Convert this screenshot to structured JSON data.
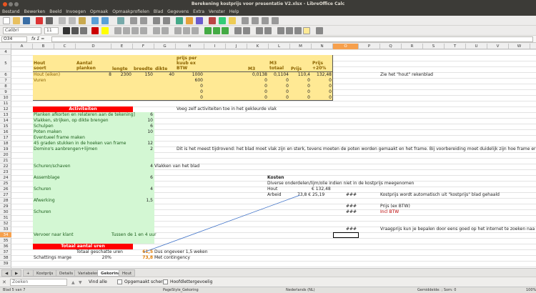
{
  "window": {
    "title": "Berekening kostprijs voor presentatie V2.xlsx - LibreOffice Calc"
  },
  "menu": [
    "Bestand",
    "Bewerken",
    "Beeld",
    "Invoegen",
    "Opmaak",
    "Opmaakprofielen",
    "Blad",
    "Gegevens",
    "Extra",
    "Venster",
    "Help"
  ],
  "toolbar": {
    "font_name": "Calibri",
    "font_size": "11"
  },
  "formula_bar": {
    "name_box": "O34",
    "fx": "fx Σ ="
  },
  "columns": [
    "A",
    "B",
    "C",
    "D",
    "E",
    "F",
    "G",
    "H",
    "I",
    "J",
    "K",
    "L",
    "M",
    "N",
    "O",
    "P",
    "Q",
    "R",
    "S",
    "T",
    "U",
    "V",
    "W"
  ],
  "selected_column": "O",
  "rows": [
    "4",
    "5",
    "6",
    "7",
    "8",
    "9",
    "10",
    "11",
    "12",
    "13",
    "14",
    "15",
    "16",
    "17",
    "18",
    "19",
    "20",
    "21",
    "22",
    "23",
    "24",
    "25",
    "26",
    "27",
    "28",
    "29",
    "30",
    "31",
    "32",
    "33",
    "34",
    "35",
    "36",
    "37",
    "38",
    "39",
    "40"
  ],
  "selected_row": "34",
  "header_table": {
    "hout_soort": "Hout soort",
    "aantal_planken": "Aantal planken",
    "lengte": "lengte",
    "breedte": "breedte",
    "dikte": "dikte",
    "prijs_per_kuub": "prijs per kuub ex BTW",
    "m3": "M3",
    "m3_totaal": "M3 totaal",
    "prijs": "Prijs",
    "prijs_20": "Prijs +20%",
    "rows": [
      {
        "name": "Hout (eiken)",
        "aantal": "8",
        "lengte": "2300",
        "breedte": "150",
        "dikte": "40",
        "prijs": "1000",
        "m3": "0,0138",
        "m3t": "0,1104",
        "p": "110,4",
        "p20": "132,48"
      },
      {
        "name": "Vuren",
        "aantal": "",
        "lengte": "",
        "breedte": "",
        "dikte": "",
        "prijs": "600",
        "m3": "0",
        "m3t": "0",
        "p": "0",
        "p20": "0"
      },
      {
        "name": "",
        "aantal": "",
        "lengte": "",
        "breedte": "",
        "dikte": "",
        "prijs": "0",
        "m3": "0",
        "m3t": "0",
        "p": "0",
        "p20": "0"
      },
      {
        "name": "",
        "aantal": "",
        "lengte": "",
        "breedte": "",
        "dikte": "",
        "prijs": "0",
        "m3": "0",
        "m3t": "0",
        "p": "0",
        "p20": "0"
      },
      {
        "name": "",
        "aantal": "",
        "lengte": "",
        "breedte": "",
        "dikte": "",
        "prijs": "0",
        "m3": "0",
        "m3t": "0",
        "p": "0",
        "p20": "0"
      }
    ],
    "note": "Zie het \"hout\" rekenblad"
  },
  "activiteiten": {
    "header": "Activiteiten",
    "items": [
      {
        "label": "Planken afkorten en relateren aan de tekening]",
        "hours": "6"
      },
      {
        "label": "Vlakken, strijken, op dikte brengen",
        "hours": "10"
      },
      {
        "label": "Schulpen",
        "hours": "6"
      },
      {
        "label": "Poten maken",
        "hours": "10"
      },
      {
        "label": "Eventueel frame maken",
        "hours": ""
      },
      {
        "label": "45 graden stukken in de hoeken van frame",
        "hours": "12"
      },
      {
        "label": "Domino's aanbrengen+lijmen",
        "hours": "2"
      },
      {
        "label": "Schuren/schaven",
        "hours": "4"
      },
      {
        "label": "Assemblage",
        "hours": "6"
      },
      {
        "label": "Schuren",
        "hours": "4"
      },
      {
        "label": "Afwerking",
        "hours": "1,5"
      },
      {
        "label": "Schuren",
        "hours": ""
      },
      {
        "label": "Vervoer naar klant",
        "hours": "Tussen de 1 en 4 uur"
      }
    ],
    "note_add": "Voeg zelf activiteiten toe in het gekleurde vlak",
    "note_hard": "Dit is het meest tijdrovend: het blad moet vlak zijn en sterk, tevens moeten de poten worden gemaakt en het frame. Bij voorbereiding moet duidelijk zijn hoe frame er",
    "note_vlakken": "Vlakken van het blad"
  },
  "totaal": {
    "header": "Totaal aantal uren",
    "geschat_label": "Totaal geschatte uren",
    "geschat_value": "61,5",
    "geschat_note": "Dus ongeveer 1,5 weken",
    "marge_label": "Schattings marge",
    "marge_value": "20%",
    "contingency_value": "73,8",
    "contingency_note": "Met contingency"
  },
  "kosten": {
    "title": "Kosten",
    "subtitle": "Diverse onderdelen/lijm/olie indien niet in de kostprijs meegenomen",
    "hout_label": "Hout",
    "hout_value": "€   132,48",
    "arbeid_label": "Arbeid",
    "arbeid_calc": "73,8  €  25,19",
    "hash": "###",
    "note_hout": "Kostprijs wordt automatisch uit \"kostprijs\" blad gehaald",
    "prijs_ex": "Prijs (ex BTW)",
    "incl": "Incl BTW",
    "vraag": "Vraagprijs kun je bepalen door eens goed op het internet te zoeken naa"
  },
  "tabs": [
    "Kostprijs",
    "Details",
    "Variabelen",
    "Gekoring",
    "Hout"
  ],
  "active_tab": "Gekoring",
  "find": {
    "placeholder": "Zoeken",
    "find_all": "Vind alle",
    "opt1": "Opgemaakt scherm",
    "opt2": "Hoofdlettergevoelig"
  },
  "status": {
    "sheet": "Blad 5 van 7",
    "style": "PageStyle_Gekoring",
    "lang": "Nederlands (NL)",
    "sum": "Gemiddelde: ; Som: 0",
    "zoom": "100%"
  }
}
